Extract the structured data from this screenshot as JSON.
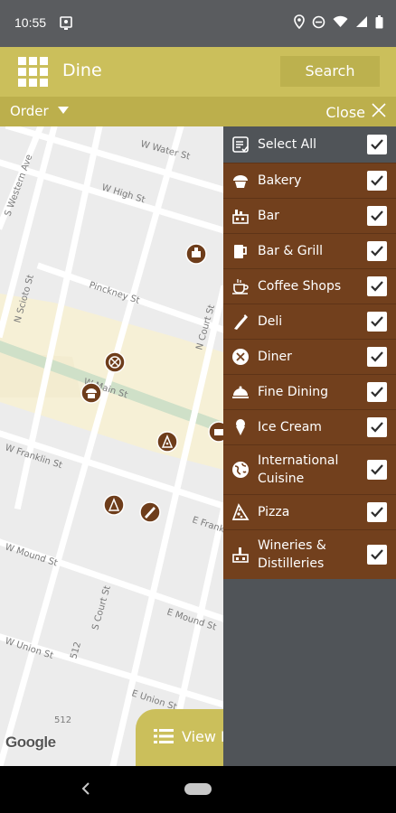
{
  "status_bar": {
    "time": "10:55"
  },
  "app_bar": {
    "title": "Dine",
    "search_label": "Search",
    "menu_icon": "grid-menu-icon"
  },
  "sub_bar": {
    "order_label": "Order",
    "close_label": "Close"
  },
  "map": {
    "streets": [
      "W Water St",
      "W High St",
      "Pinckney St",
      "N Scioto St",
      "S Western Ave",
      "N Court St",
      "W Main St",
      "W Franklin St",
      "E Frankl",
      "W Mound St",
      "S Court St",
      "E Mound St",
      "W Union St",
      "E Union St",
      "512",
      "512"
    ],
    "attribution": "Google"
  },
  "view_list": {
    "label": "View List",
    "icon": "list-icon"
  },
  "filter": {
    "select_all": {
      "label": "Select All",
      "icon": "list-check-icon",
      "checked": true
    },
    "categories": [
      {
        "label": "Bakery",
        "icon": "bakery-icon",
        "checked": true
      },
      {
        "label": "Bar",
        "icon": "bar-icon",
        "checked": true
      },
      {
        "label": "Bar & Grill",
        "icon": "beer-mug-icon",
        "checked": true
      },
      {
        "label": "Coffee Shops",
        "icon": "coffee-cup-icon",
        "checked": true
      },
      {
        "label": "Deli",
        "icon": "sandwich-icon",
        "checked": true
      },
      {
        "label": "Diner",
        "icon": "diner-plate-icon",
        "checked": true
      },
      {
        "label": "Fine Dining",
        "icon": "cloche-icon",
        "checked": true
      },
      {
        "label": "Ice Cream",
        "icon": "ice-cream-icon",
        "checked": true
      },
      {
        "label": "International Cuisine",
        "icon": "globe-icon",
        "checked": true
      },
      {
        "label": "Pizza",
        "icon": "pizza-icon",
        "checked": true
      },
      {
        "label": "Wineries & Distilleries",
        "icon": "winery-icon",
        "checked": true
      }
    ]
  },
  "colors": {
    "accent": "#cbbf5b",
    "category_bg": "#72401d",
    "panel_bg": "#505458"
  }
}
